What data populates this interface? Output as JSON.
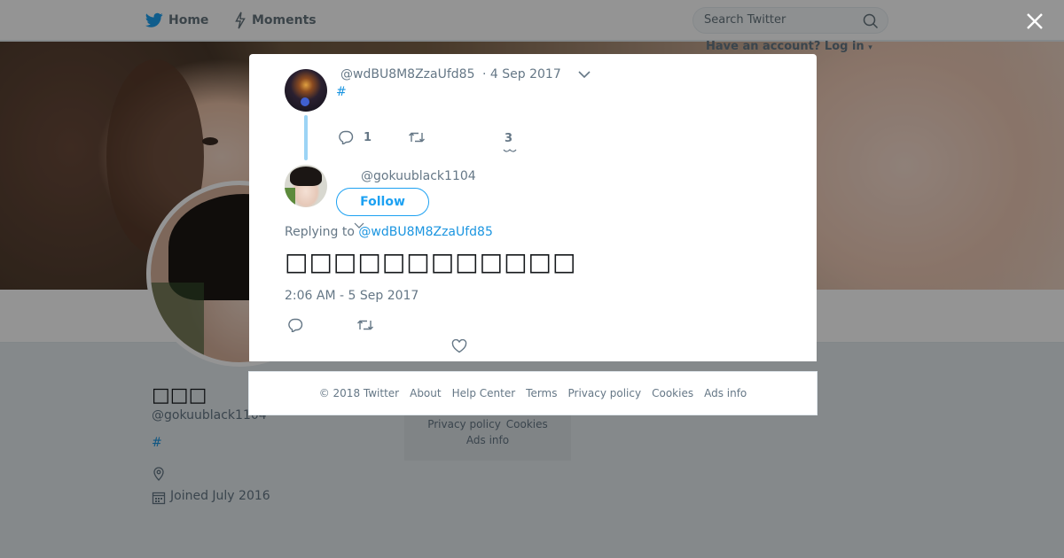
{
  "nav": {
    "home_label": "Home",
    "moments_label": "Moments",
    "search_placeholder": "Search Twitter",
    "login_text": "Have an account? Log in"
  },
  "profile": {
    "name": "□□□",
    "handle": "@gokuublack1104",
    "hashtag": "#",
    "joined": "Joined July 2016"
  },
  "sidebar_footer": {
    "privacy": "Privacy policy",
    "cookies": "Cookies",
    "ads": "Ads info"
  },
  "modal": {
    "parent_tweet": {
      "handle": "@wdBU8M8ZzaUfd85",
      "date": "· 4 Sep 2017",
      "text": "#",
      "reply_count": "1",
      "like_count": "3"
    },
    "reply_tweet": {
      "handle": "@gokuublack1104",
      "follow_label": "Follow",
      "replying_prefix": "Replying to",
      "replying_to": "@wdBU8M8ZzaUfd85",
      "text": "□□□□□□□□□□□□",
      "timestamp": "2:06 AM - 5 Sep 2017"
    }
  },
  "footer": {
    "copyright": "© 2018 Twitter",
    "about": "About",
    "help": "Help Center",
    "terms": "Terms",
    "privacy": "Privacy policy",
    "cookies": "Cookies",
    "ads": "Ads info"
  },
  "colors": {
    "accent": "#1da1f2",
    "link": "#1b95e0",
    "muted": "#657786",
    "thread_line": "#9cd4f5"
  },
  "icons": [
    "twitter-bird-icon",
    "lightning-icon",
    "search-icon",
    "close-icon",
    "chevron-down-icon",
    "reply-icon",
    "retweet-icon",
    "heart-icon",
    "location-icon",
    "calendar-icon"
  ]
}
